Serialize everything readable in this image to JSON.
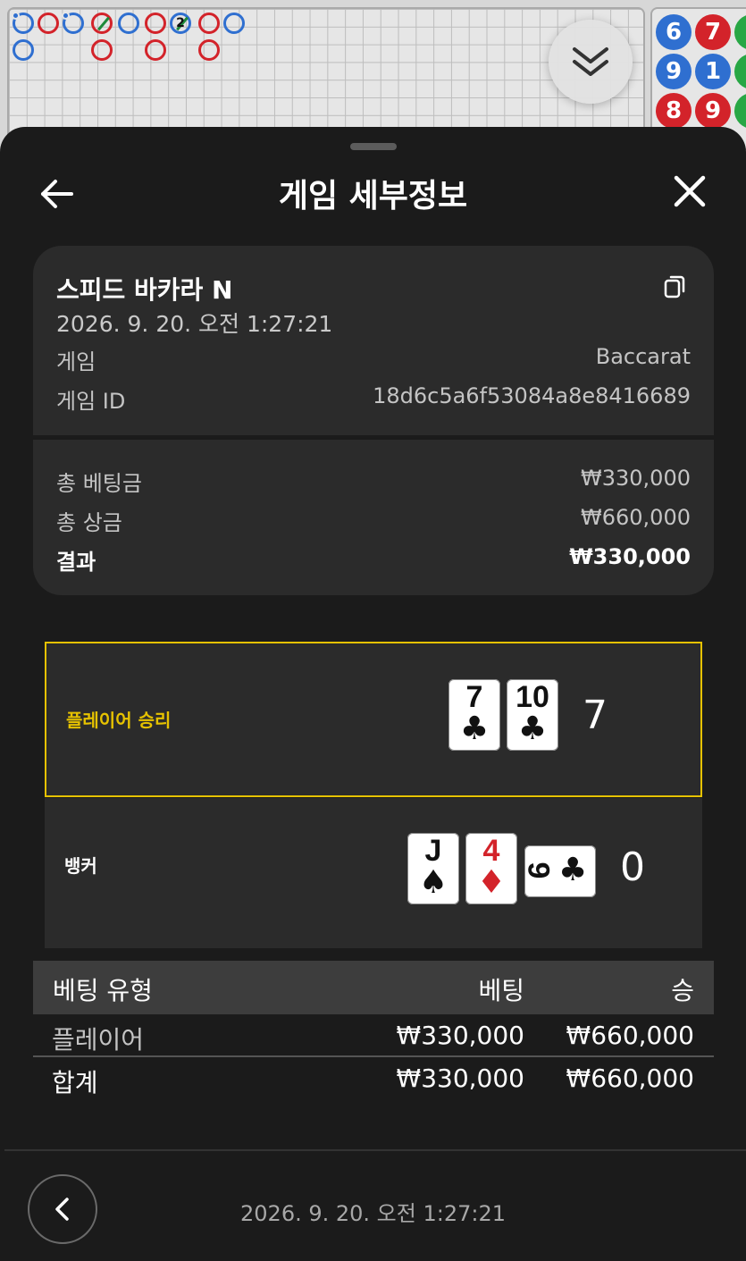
{
  "header": {
    "title": "게임 세부정보"
  },
  "game": {
    "name": "스피드 바카라 N",
    "datetime": "2026. 9. 20. 오전 1:27:21",
    "type_label": "게임",
    "type_value": "Baccarat",
    "id_label": "게임 ID",
    "id_value": "18d6c5a6f53084a8e8416689"
  },
  "summary": {
    "total_bet_label": "총 베팅금",
    "total_bet_value": "₩330,000",
    "total_win_label": "총 상금",
    "total_win_value": "₩660,000",
    "result_label": "결과",
    "result_value": "₩330,000"
  },
  "outcome": {
    "player": {
      "label": "플레이어 승리",
      "score": "7",
      "cards": [
        {
          "rank": "7",
          "suit": "♣",
          "color": "black"
        },
        {
          "rank": "10",
          "suit": "♣",
          "color": "black"
        }
      ],
      "accent": "#e6c200"
    },
    "banker": {
      "label": "뱅커",
      "score": "0",
      "cards": [
        {
          "rank": "J",
          "suit": "♠",
          "color": "black"
        },
        {
          "rank": "4",
          "suit": "♦",
          "color": "red"
        },
        {
          "rank": "9",
          "suit": "♣",
          "color": "black",
          "rotated": true
        }
      ]
    }
  },
  "bets_table": {
    "columns": [
      "베팅 유형",
      "베팅",
      "승"
    ],
    "rows": [
      {
        "type": "플레이어",
        "bet": "₩330,000",
        "win": "₩660,000"
      }
    ],
    "total": {
      "type": "합계",
      "bet": "₩330,000",
      "win": "₩660,000"
    }
  },
  "footer": {
    "datetime": "2026. 9. 20. 오전 1:27:21"
  },
  "background": {
    "bead_road_values": [
      "6",
      "7",
      "9",
      "1",
      "8",
      "9"
    ],
    "big_road_marker": "2"
  },
  "colors": {
    "player_blue": "#2f6fd0",
    "banker_red": "#d3232a",
    "win_accent": "#e6c200"
  }
}
